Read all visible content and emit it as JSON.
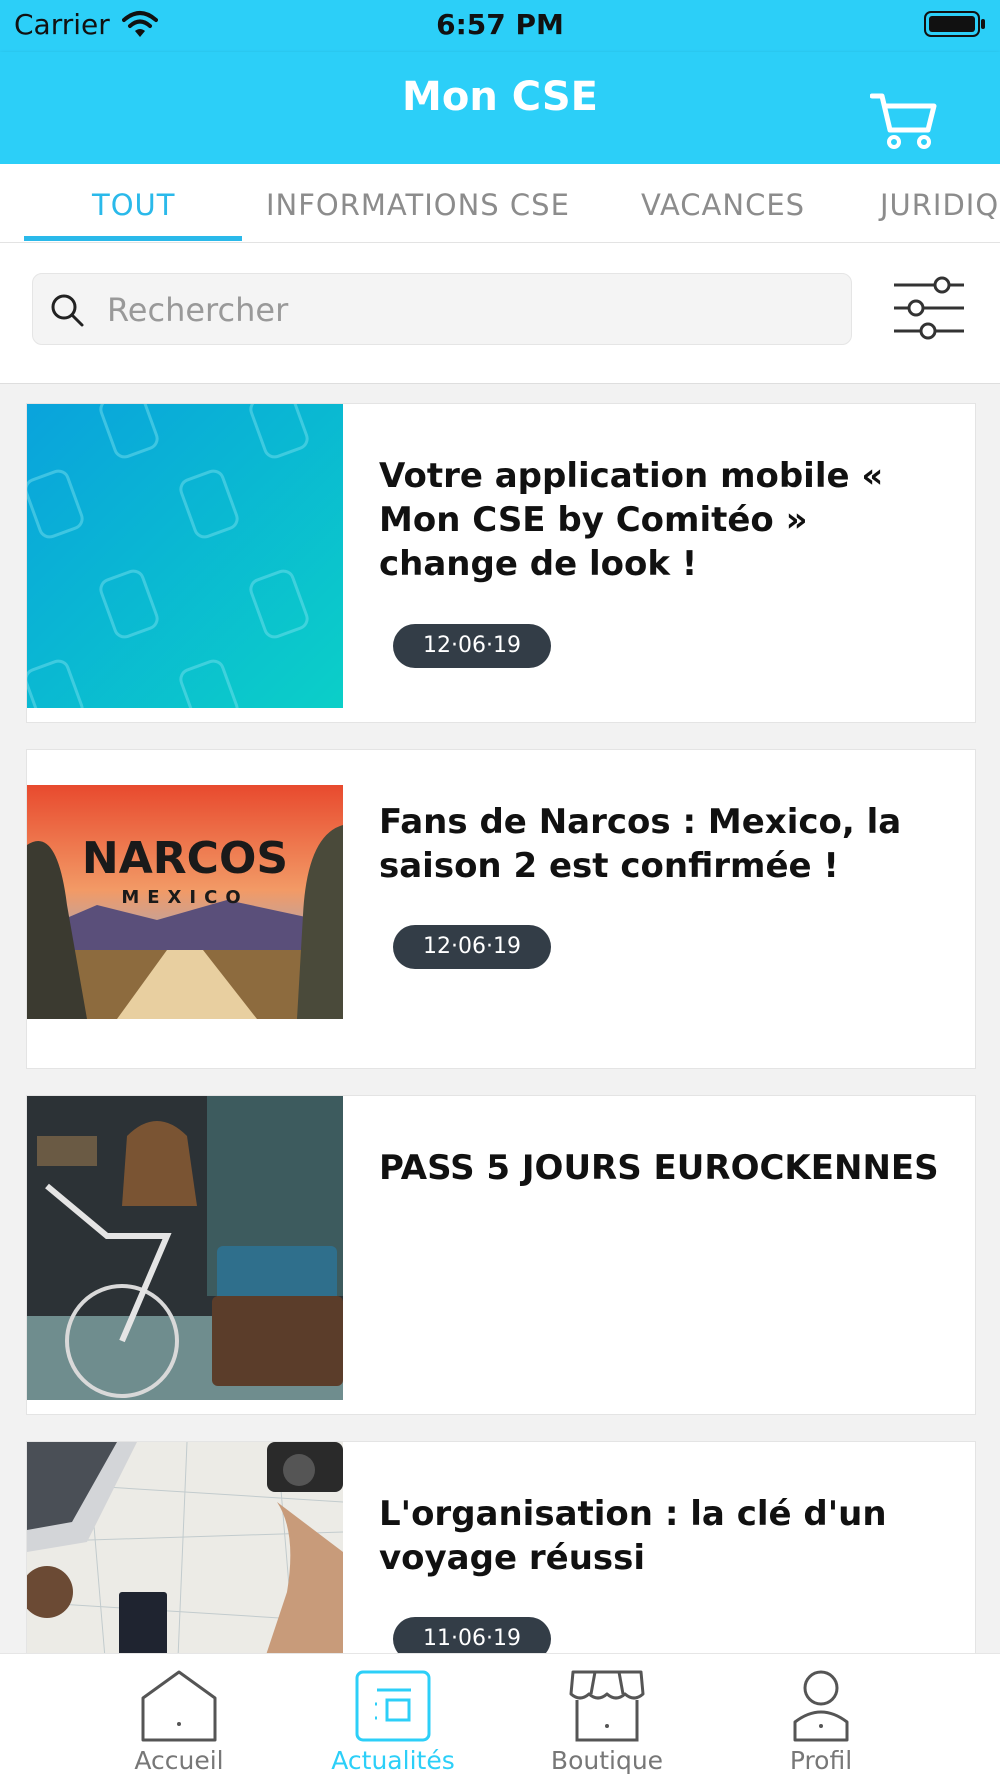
{
  "status_bar": {
    "carrier": "Carrier",
    "time": "6:57 PM"
  },
  "header": {
    "title": "Mon CSE",
    "cart_icon": "cart-icon"
  },
  "tabs": [
    {
      "label": "TOUT",
      "active": true
    },
    {
      "label": "INFORMATIONS CSE",
      "active": false
    },
    {
      "label": "VACANCES",
      "active": false
    },
    {
      "label": "JURIDIQUE",
      "active": false
    }
  ],
  "search": {
    "placeholder": "Rechercher",
    "value": "",
    "icon": "search-icon",
    "filter_icon": "sliders-icon"
  },
  "articles": [
    {
      "title": "Votre application mobile « Mon CSE by Comitéo » change de look !",
      "date": "12·06·19",
      "image": "phone-pattern-gradient"
    },
    {
      "title": "Fans de Narcos : Mexico, la saison 2 est confirmée !",
      "date": "12·06·19",
      "image": "narcos-poster",
      "image_text": {
        "line1": "NARCOS",
        "line2": "MEXICO"
      }
    },
    {
      "title": "PASS 5 JOURS EUROCKENNES",
      "date": "",
      "image": "bicycle-and-suitcase"
    },
    {
      "title": "L'organisation : la clé d'un voyage réussi",
      "date": "11·06·19",
      "image": "map-passport-camera"
    }
  ],
  "bottom_nav": [
    {
      "label": "Accueil",
      "icon": "home-icon",
      "active": false
    },
    {
      "label": "Actualités",
      "icon": "news-icon",
      "active": true
    },
    {
      "label": "Boutique",
      "icon": "shop-icon",
      "active": false
    },
    {
      "label": "Profil",
      "icon": "profile-icon",
      "active": false
    }
  ],
  "colors": {
    "accent": "#2ccff8",
    "active_tab": "#2ab9ea",
    "badge": "#333d47"
  }
}
